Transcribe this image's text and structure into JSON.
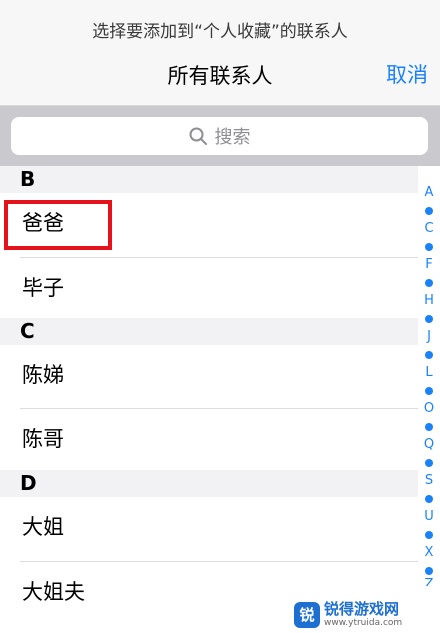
{
  "header": {
    "prompt": "选择要添加到“个人收藏”的联系人",
    "title": "所有联系人",
    "cancel_label": "取消"
  },
  "search": {
    "placeholder": "搜索",
    "icon": "search-icon"
  },
  "sections": [
    {
      "letter": "B",
      "contacts": [
        "爸爸",
        "毕子"
      ]
    },
    {
      "letter": "C",
      "contacts": [
        "陈娣",
        "陈哥"
      ]
    },
    {
      "letter": "D",
      "contacts": [
        "大姐",
        "大姐夫"
      ]
    }
  ],
  "index": [
    "A",
    "C",
    "F",
    "H",
    "J",
    "L",
    "O",
    "Q",
    "S",
    "U",
    "X",
    "Z"
  ],
  "colors": {
    "accent": "#1a82f7",
    "highlight": "#e4121b"
  },
  "watermark": {
    "name": "锐得游戏网",
    "url": "www.ytruida.com"
  }
}
